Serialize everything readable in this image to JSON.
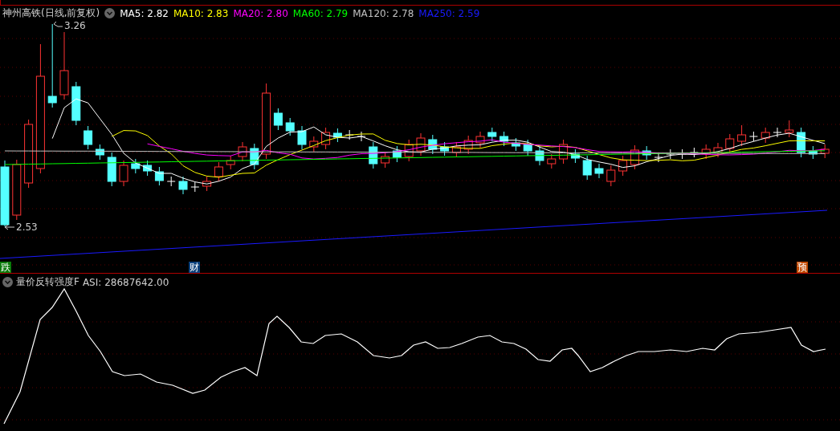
{
  "stock": {
    "name": "神州高铁(日线,前复权)",
    "ma": [
      {
        "label": "MA5: 2.82",
        "color": "#ffffff"
      },
      {
        "label": "MA10: 2.83",
        "color": "#ffff00"
      },
      {
        "label": "MA20: 2.80",
        "color": "#ff00ff"
      },
      {
        "label": "MA60: 2.79",
        "color": "#00ff00"
      },
      {
        "label": "MA120: 2.78",
        "color": "#c0c0c0"
      },
      {
        "label": "MA250: 2.59",
        "color": "#1a1aff"
      }
    ]
  },
  "price_marks": {
    "high": "3.26",
    "low": "2.53"
  },
  "events": [
    {
      "label": "跌",
      "color": "#0a7a0a"
    },
    {
      "label": "财",
      "color": "#0a3f7a"
    },
    {
      "label": "预",
      "color": "#c04800"
    }
  ],
  "indicator": {
    "name": "量价反转强度F",
    "reading": "ASI: 28687642.00"
  }
}
